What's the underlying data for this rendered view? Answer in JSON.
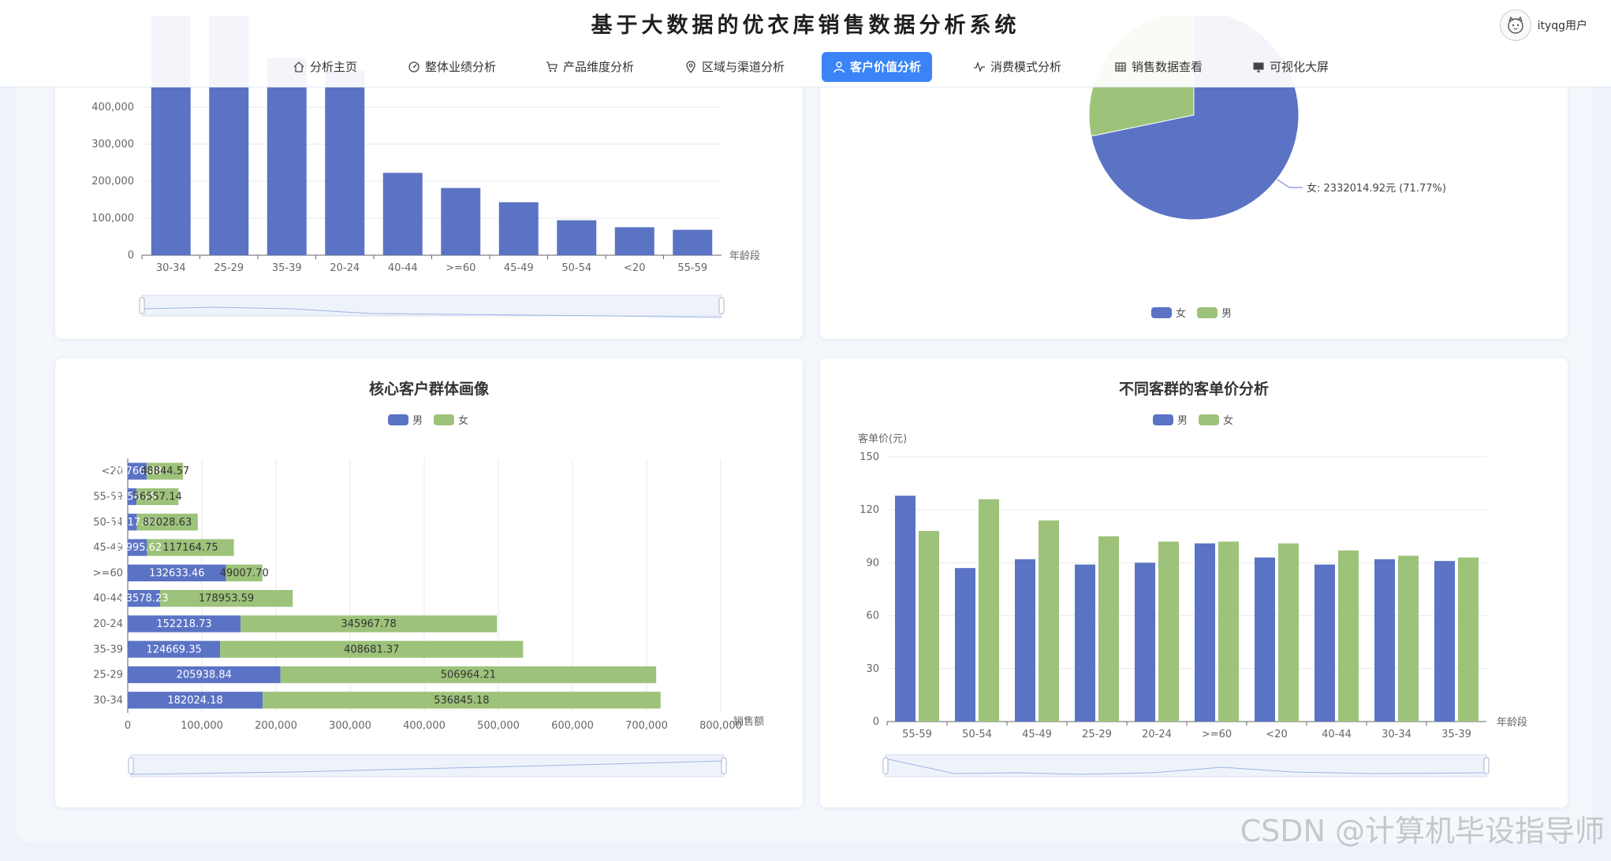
{
  "header": {
    "system_title": "基于大数据的优衣库销售数据分析系统",
    "username": "ityqg用户"
  },
  "nav": {
    "items": [
      {
        "label": "分析主页",
        "icon": "home-icon",
        "active": false
      },
      {
        "label": "整体业绩分析",
        "icon": "dashboard-icon",
        "active": false
      },
      {
        "label": "产品维度分析",
        "icon": "cart-icon",
        "active": false
      },
      {
        "label": "区域与渠道分析",
        "icon": "location-icon",
        "active": false
      },
      {
        "label": "客户价值分析",
        "icon": "user-icon",
        "active": true
      },
      {
        "label": "消费模式分析",
        "icon": "pulse-icon",
        "active": false
      },
      {
        "label": "销售数据查看",
        "icon": "table-icon",
        "active": false
      },
      {
        "label": "可视化大屏",
        "icon": "monitor-icon",
        "active": false
      }
    ]
  },
  "colors": {
    "blue": "#5b73c4",
    "green": "#9dc27a",
    "accent": "#3a84f8"
  },
  "watermark": "CSDN @计算机毕设指导师",
  "chart_data": [
    {
      "id": "age-sales",
      "type": "bar",
      "title": "",
      "categories": [
        "30-34",
        "25-29",
        "35-39",
        "20-24",
        "40-44",
        ">=60",
        "45-49",
        "50-54",
        "<20",
        "55-59"
      ],
      "values": [
        718869,
        712903,
        533351,
        498187,
        222532,
        181641,
        143160,
        94446,
        75522,
        68720
      ],
      "ylim": [
        0,
        400000
      ],
      "yticks": [
        "0",
        "100,000",
        "200,000",
        "300,000",
        "400,000"
      ],
      "xlabel": "年龄段",
      "grid": true
    },
    {
      "id": "gender-pie",
      "type": "pie",
      "slices": [
        {
          "name": "女",
          "value": 2332014.92,
          "percent": 71.77
        },
        {
          "name": "男",
          "value": 917200,
          "percent": 28.23
        }
      ],
      "label": "女: 2332014.92元 (71.77%)",
      "legend": [
        "女",
        "男"
      ],
      "legend_position": "bottom"
    },
    {
      "id": "core-portrait",
      "type": "bar",
      "orientation": "horizontal-stacked",
      "title": "核心客户群体画像",
      "legend": [
        "男",
        "女"
      ],
      "categories": [
        "30-34",
        "25-29",
        "35-39",
        "20-24",
        "40-44",
        ">=60",
        "45-49",
        "50-54",
        "55-59",
        "<20"
      ],
      "series": [
        {
          "name": "男",
          "values": [
            182024.18,
            205938.84,
            124669.35,
            152218.73,
            43578.23,
            132633.46,
            25995.62,
            12417.82,
            11856.75,
            25766.48
          ]
        },
        {
          "name": "女",
          "values": [
            536845.18,
            506964.21,
            408681.37,
            345967.78,
            178953.59,
            49007.7,
            117164.75,
            82028.63,
            56557.14,
            48844.57
          ]
        }
      ],
      "labels": {
        "男": [
          "182024.18",
          "205938.84",
          "124669.35",
          "152218.73",
          "43578.23",
          "132633.46",
          "25995.62",
          "12417.82",
          "11856.75",
          "25766.48"
        ],
        "女": [
          "536845.18",
          "506964.21",
          "408681.37",
          "345967.78",
          "178953.59",
          "49007.70",
          "117164.75",
          "82028.63",
          "56557.14",
          "48844.57"
        ]
      },
      "xlim": [
        0,
        800000
      ],
      "xticks": [
        "0",
        "100,000",
        "200,000",
        "300,000",
        "400,000",
        "500,000",
        "600,000",
        "700,000",
        "800,000"
      ],
      "xlabel": "销售额",
      "grid": true
    },
    {
      "id": "avg-order",
      "type": "bar",
      "title": "不同客群的客单价分析",
      "legend": [
        "男",
        "女"
      ],
      "ylabel": "客单价(元)",
      "xlabel": "年龄段",
      "categories": [
        "55-59",
        "50-54",
        "45-49",
        "25-29",
        "20-24",
        ">=60",
        "<20",
        "40-44",
        "30-34",
        "35-39"
      ],
      "series": [
        {
          "name": "男",
          "values": [
            128,
            87,
            92,
            89,
            90,
            101,
            93,
            89,
            92,
            91
          ]
        },
        {
          "name": "女",
          "values": [
            108,
            126,
            114,
            105,
            102,
            102,
            101,
            97,
            94,
            93
          ]
        }
      ],
      "ylim": [
        0,
        150
      ],
      "yticks": [
        "0",
        "30",
        "60",
        "90",
        "120",
        "150"
      ],
      "grid": true
    }
  ]
}
